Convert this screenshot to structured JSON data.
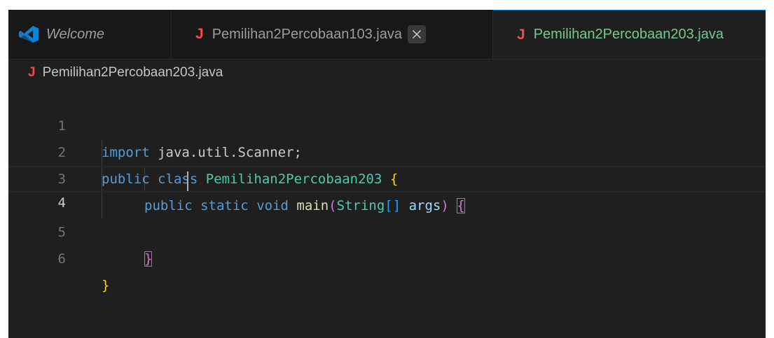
{
  "tabs": [
    {
      "label": "Welcome",
      "icon": "vscode-icon",
      "active": false
    },
    {
      "label": "Pemilihan2Percobaan103.java",
      "icon": "java-icon",
      "icon_text": "J",
      "active": false,
      "has_close": true,
      "close_glyph": "✕"
    },
    {
      "label": "Pemilihan2Percobaan203.java",
      "icon": "java-icon",
      "icon_text": "J",
      "active": true
    }
  ],
  "breadcrumb": {
    "icon_text": "J",
    "file": "Pemilihan2Percobaan203.java"
  },
  "editor": {
    "current_line": 4,
    "lines": [
      {
        "num": "1",
        "tokens": {
          "kw": "import",
          "pkg": " java.util.Scanner;"
        }
      },
      {
        "num": "2",
        "tokens": {
          "kw1": "public",
          "kw2": "class",
          "cls": "Pemilihan2Percobaan203",
          "brace": "{"
        }
      },
      {
        "num": "3",
        "tokens": {
          "kw1": "public",
          "kw2": "static",
          "kw3": "void",
          "fn": "main",
          "paren_open": "(",
          "type": "String",
          "arr": "[]",
          "arg": "args",
          "paren_close": ")",
          "brace": "{"
        }
      },
      {
        "num": "4",
        "tokens": {}
      },
      {
        "num": "5",
        "tokens": {
          "brace": "}"
        }
      },
      {
        "num": "6",
        "tokens": {
          "brace": "}"
        }
      }
    ]
  },
  "colors": {
    "editor_bg": "#1f1f1f",
    "tabbar_bg": "#181818",
    "active_tab_accent": "#0078d4",
    "modified_file_label": "#73c991",
    "java_icon": "#f14c4c",
    "keyword": "#569cd6",
    "class_name": "#4ec9b0",
    "function": "#dcdcaa",
    "variable": "#9cdcfe",
    "bracket_level1": "#ffd700",
    "bracket_level2": "#da70d6",
    "bracket_level3": "#179fff"
  }
}
